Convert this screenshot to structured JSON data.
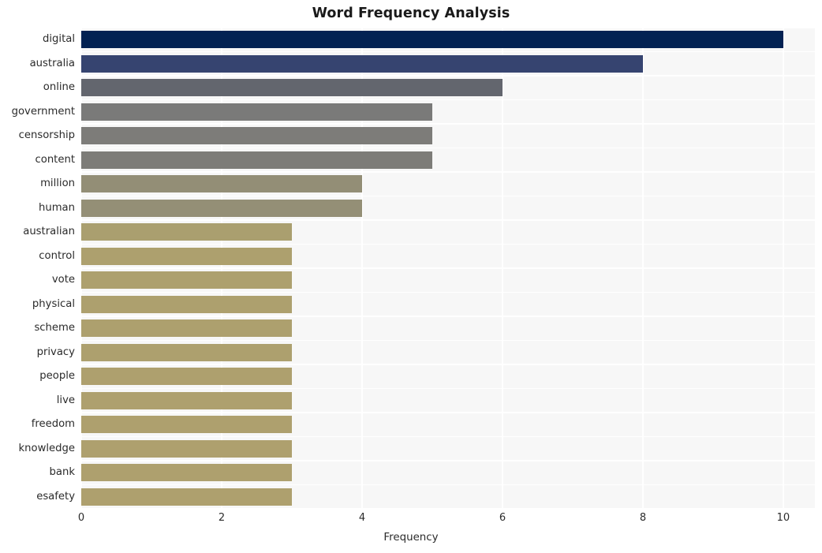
{
  "chart_data": {
    "type": "bar",
    "orientation": "horizontal",
    "title": "Word Frequency Analysis",
    "xlabel": "Frequency",
    "ylabel": "",
    "xlim": [
      0,
      10.45
    ],
    "xticks": [
      0,
      2,
      4,
      6,
      8,
      10
    ],
    "xticklabels": [
      "0",
      "2",
      "4",
      "6",
      "8",
      "10"
    ],
    "grid": true,
    "grid_color": "#ffffff",
    "plot_background": "#f7f7f7",
    "legend": null,
    "categories": [
      "digital",
      "australia",
      "online",
      "government",
      "censorship",
      "content",
      "million",
      "human",
      "australian",
      "control",
      "vote",
      "physical",
      "scheme",
      "privacy",
      "people",
      "live",
      "freedom",
      "knowledge",
      "bank",
      "esafety"
    ],
    "values": [
      10,
      8,
      6,
      5,
      5,
      5,
      4,
      4,
      3,
      3,
      3,
      3,
      3,
      3,
      3,
      3,
      3,
      3,
      3,
      3
    ],
    "bar_colors": [
      "#032253",
      "#364470",
      "#63666e",
      "#7a7a79",
      "#7d7c79",
      "#7d7c78",
      "#938e76",
      "#948f76",
      "#aa9f6f",
      "#ada06e",
      "#ada06e",
      "#ada06e",
      "#ada06e",
      "#ada06e",
      "#aea06e",
      "#aea06e",
      "#aea06e",
      "#aea06e",
      "#aea06e",
      "#aea06e"
    ]
  }
}
